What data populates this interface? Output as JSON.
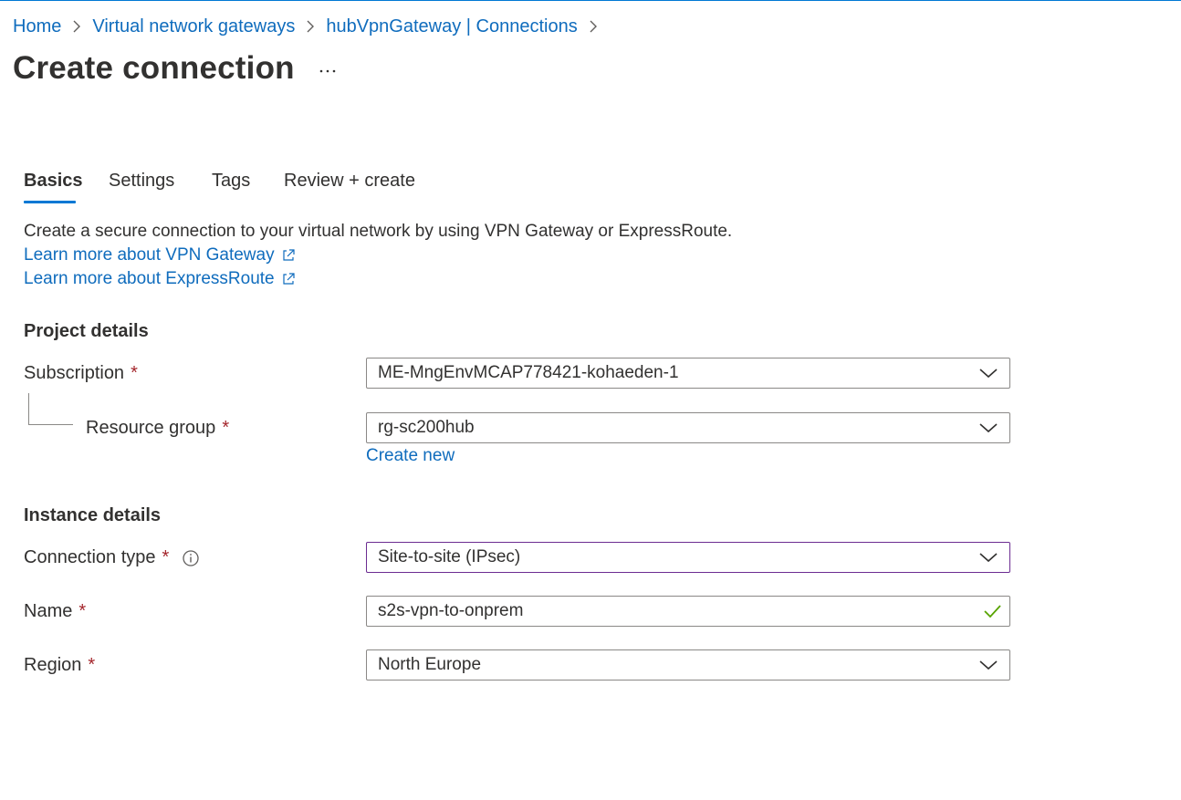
{
  "breadcrumb": {
    "items": [
      {
        "label": "Home"
      },
      {
        "label": "Virtual network gateways"
      },
      {
        "label": "hubVpnGateway | Connections"
      }
    ]
  },
  "header": {
    "title": "Create connection",
    "more_label": "..."
  },
  "tabs": [
    {
      "label": "Basics",
      "active": true
    },
    {
      "label": "Settings",
      "active": false
    },
    {
      "label": "Tags",
      "active": false
    },
    {
      "label": "Review + create",
      "active": false
    }
  ],
  "intro": {
    "text": "Create a secure connection to your virtual network by using VPN Gateway or ExpressRoute.",
    "link_vpn": "Learn more about VPN Gateway",
    "link_expressroute": "Learn more about ExpressRoute"
  },
  "project_details": {
    "heading": "Project details",
    "subscription": {
      "label": "Subscription",
      "required_mark": "*",
      "value": "ME-MngEnvMCAP778421-kohaeden-1"
    },
    "resource_group": {
      "label": "Resource group",
      "required_mark": "*",
      "value": "rg-sc200hub",
      "create_new": "Create new"
    }
  },
  "instance_details": {
    "heading": "Instance details",
    "connection_type": {
      "label": "Connection type",
      "required_mark": "*",
      "value": "Site-to-site (IPsec)"
    },
    "name": {
      "label": "Name",
      "required_mark": "*",
      "value": "s2s-vpn-to-onprem"
    },
    "region": {
      "label": "Region",
      "required_mark": "*",
      "value": "North Europe"
    }
  },
  "colors": {
    "link": "#0f6cbd",
    "accent": "#0078d4",
    "required": "#a4262c",
    "valid_check": "#57a300",
    "focus_border": "#6b2c91"
  },
  "icons": {
    "breadcrumb_separator": "chevron-right-icon",
    "external_link": "external-link-icon",
    "dropdown": "chevron-down-icon",
    "info": "info-icon",
    "valid": "checkmark-icon"
  }
}
